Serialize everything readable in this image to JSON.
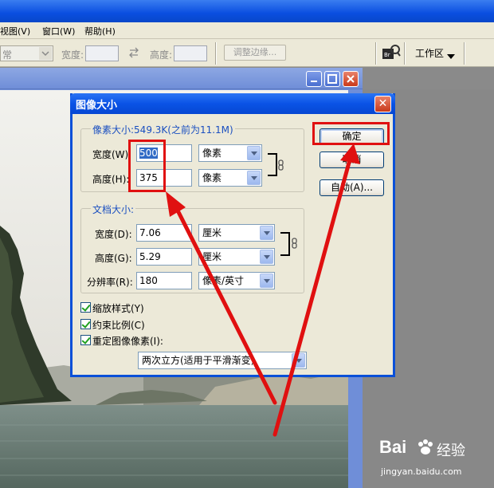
{
  "menu": {
    "view": "视图(V)",
    "window": "窗口(W)",
    "help": "帮助(H)"
  },
  "options_bar": {
    "mode_value": "常",
    "width_label": "宽度:",
    "height_label": "高度:",
    "refine_edge_label": "调整边缘...",
    "workspace_label": "工作区",
    "swap_icon": "swap-arrows-icon",
    "bridge_icon": "bridge-icon"
  },
  "dialog": {
    "title": "图像大小",
    "close_label": "✕",
    "pixel_dimensions": {
      "legend": "像素大小:549.3K(之前为11.1M)",
      "width_label": "宽度(W):",
      "width_value": "500",
      "width_unit": "像素",
      "height_label": "高度(H):",
      "height_value": "375",
      "height_unit": "像素"
    },
    "document_size": {
      "legend": "文档大小:",
      "width_label": "宽度(D):",
      "width_value": "7.06",
      "width_unit": "厘米",
      "height_label": "高度(G):",
      "height_value": "5.29",
      "height_unit": "厘米",
      "resolution_label": "分辨率(R):",
      "resolution_value": "180",
      "resolution_unit": "像素/英寸"
    },
    "checkboxes": {
      "scale_styles": "缩放样式(Y)",
      "constrain_proportions": "约束比例(C)",
      "resample_image": "重定图像像素(I):"
    },
    "resample_method": "两次立方(适用于平滑渐变)",
    "buttons": {
      "ok": "确定",
      "cancel": "取消",
      "auto": "自动(A)..."
    }
  },
  "watermark": {
    "brand": "Bai",
    "brand_suffix": "经验",
    "url": "jingyan.baidu.com"
  },
  "colors": {
    "annotation_red": "#e01010",
    "xp_blue": "#0a53e6",
    "dialog_bg": "#ece9d8"
  }
}
